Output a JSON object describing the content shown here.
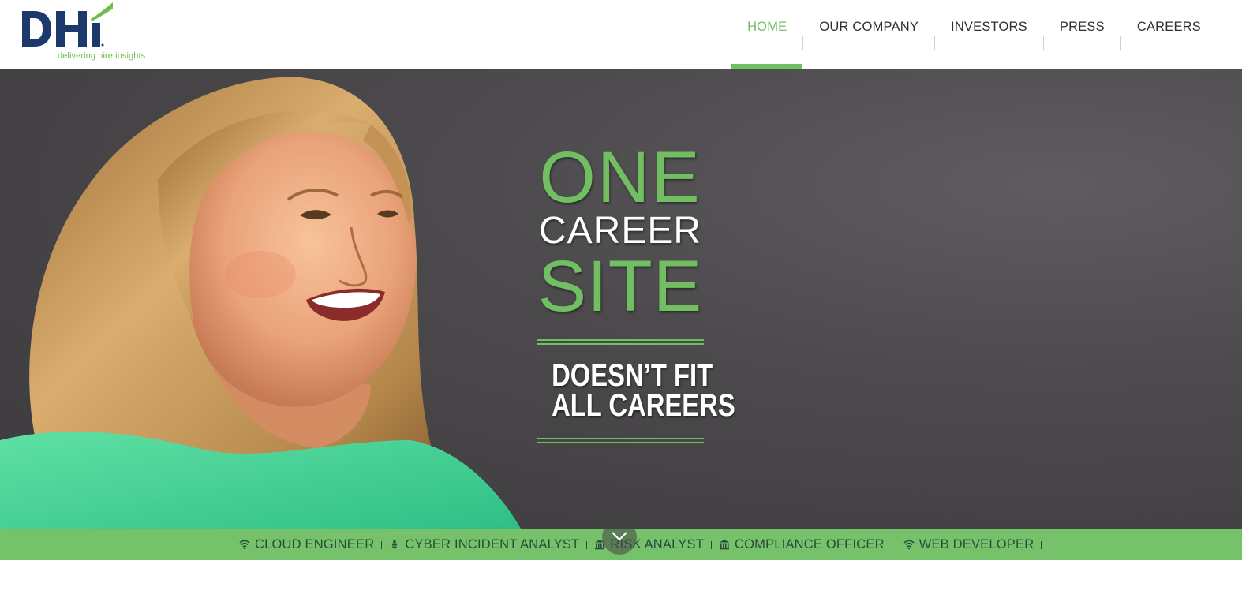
{
  "brand": {
    "logo_text": "DHI",
    "tagline": "delivering hire insights.",
    "colors": {
      "navy": "#1b3a6b",
      "green": "#72be63"
    }
  },
  "nav": {
    "items": [
      {
        "label": "HOME",
        "active": true
      },
      {
        "label": "OUR COMPANY",
        "active": false
      },
      {
        "label": "INVESTORS",
        "active": false
      },
      {
        "label": "PRESS",
        "active": false
      },
      {
        "label": "CAREERS",
        "active": false
      }
    ]
  },
  "hero": {
    "line_one": "ONE",
    "line_two": "CAREER",
    "line_three": "SITE",
    "sub_one": "DOESN’T FIT",
    "sub_two": "ALL CAREERS",
    "background_color": "#4c4a4c"
  },
  "ticker": {
    "background_color": "#75c26a",
    "items": [
      {
        "icon": "wifi-icon",
        "label": "CLOUD ENGINEER"
      },
      {
        "icon": "bug-icon",
        "label": "CYBER INCIDENT ANALYST"
      },
      {
        "icon": "bank-icon",
        "label": "RISK ANALYST"
      },
      {
        "icon": "bank-icon",
        "label": "COMPLIANCE OFFICER"
      },
      {
        "icon": "wifi-icon",
        "label": "WEB DEVELOPER"
      }
    ]
  },
  "scroll_button": {
    "icon": "chevron-down-icon"
  }
}
